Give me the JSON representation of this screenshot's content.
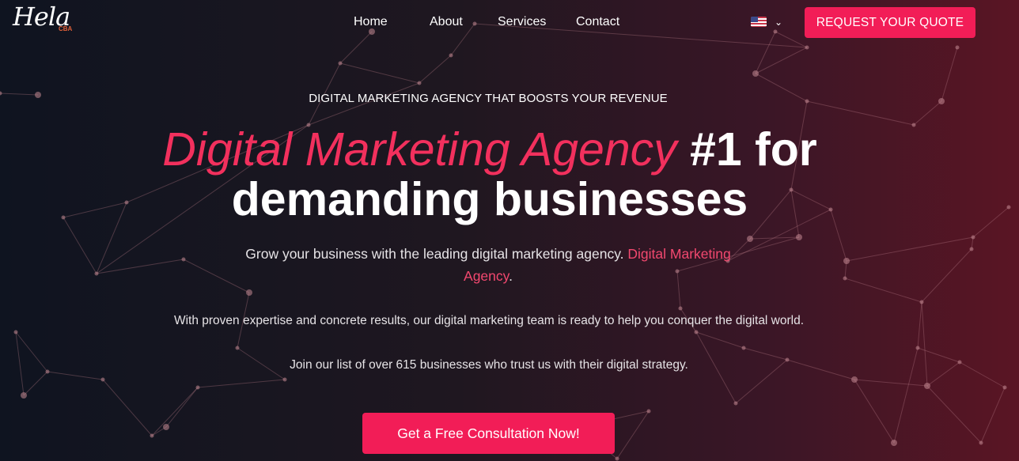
{
  "logo": {
    "script": "Hela",
    "sub": "CBA"
  },
  "nav": {
    "items": [
      "Home",
      "About",
      "Services",
      "Contact"
    ],
    "cta_label": "REQUEST YOUR QUOTE",
    "language_icon": "us-flag-icon",
    "language_chevron": "⌄"
  },
  "hero": {
    "kicker": "DIGITAL MARKETING AGENCY THAT BOOSTS YOUR REVENUE",
    "headline_accent": "Digital Marketing Agency",
    "headline_rest_1": "#1 for",
    "headline_rest_2": "demanding businesses",
    "lead_text": "Grow your business with the leading digital marketing agency.",
    "lead_link": "Digital Marketing Agency",
    "lead_end": ".",
    "paragraph_1": "With proven expertise and concrete results, our digital marketing team is ready to help you conquer the digital world.",
    "paragraph_2": "Join our list of over 615 businesses who trust us with their digital strategy.",
    "cta_label": "Get a Free Consultation Now!"
  },
  "colors": {
    "accent": "#f21d57",
    "accent_text": "#f2305d",
    "background_left": "#0f1420",
    "background_right": "#5a1524"
  }
}
